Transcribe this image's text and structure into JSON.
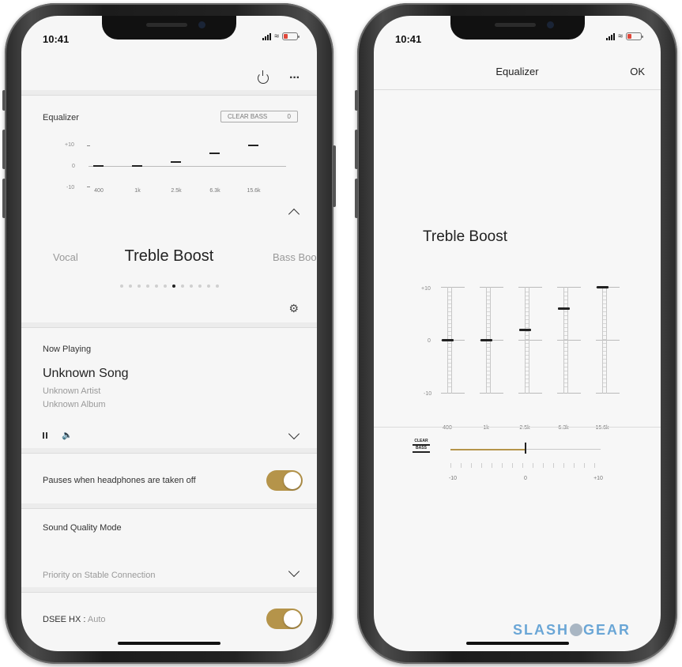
{
  "status_bar": {
    "time": "10:41"
  },
  "left": {
    "equalizer": {
      "title": "Equalizer",
      "clear_bass_label": "CLEAR BASS",
      "clear_bass_value": "0",
      "y_labels": [
        "+10",
        "0",
        "-10"
      ],
      "bands": [
        {
          "label": "400",
          "value": 0
        },
        {
          "label": "1k",
          "value": 0
        },
        {
          "label": "2.5k",
          "value": 2
        },
        {
          "label": "6.3k",
          "value": 6
        },
        {
          "label": "15.6k",
          "value": 10
        }
      ]
    },
    "presets": {
      "prev": "Vocal",
      "current": "Treble Boost",
      "next": "Bass Boo",
      "dot_count": 12,
      "active_index": 6
    },
    "now_playing": {
      "title": "Now Playing",
      "song": "Unknown Song",
      "artist": "Unknown Artist",
      "album": "Unknown Album"
    },
    "pause_setting": {
      "label": "Pauses when headphones are taken off",
      "enabled": true
    },
    "sound_quality": {
      "label": "Sound Quality Mode",
      "value": "Priority on Stable Connection"
    },
    "dsee": {
      "label": "DSEE HX :",
      "value": "Auto",
      "enabled": true
    }
  },
  "right": {
    "title": "Equalizer",
    "ok_label": "OK",
    "preset": "Treble Boost",
    "y_labels": [
      "+10",
      "0",
      "-10"
    ],
    "bands": [
      {
        "label": "400",
        "value": 0
      },
      {
        "label": "1k",
        "value": 0
      },
      {
        "label": "2.5k",
        "value": 2
      },
      {
        "label": "6.3k",
        "value": 6
      },
      {
        "label": "15.6k",
        "value": 10
      }
    ],
    "clear_bass": {
      "logo_text_top": "CLEAR",
      "logo_text_bottom": "BASS",
      "min_label": "-10",
      "mid_label": "0",
      "max_label": "+10",
      "value": 0
    }
  },
  "watermark": {
    "left": "SLASH",
    "right": "GEAR"
  },
  "colors": {
    "accent_gold": "#b5944a",
    "watermark_blue": "#6aa6d6"
  }
}
